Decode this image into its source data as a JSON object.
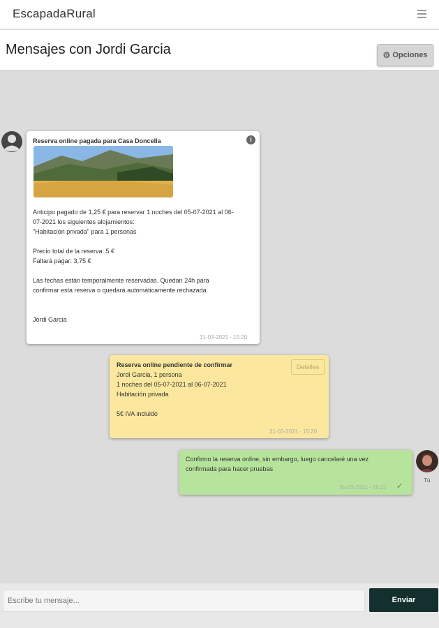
{
  "app": {
    "brand": "EscapadaRural",
    "menu_icon": "hamburger-icon"
  },
  "header": {
    "title": "Mensajes con Jordi Garcia",
    "options_label": "Opciones",
    "options_icon": "gear-icon"
  },
  "messages": [
    {
      "title": "Reserva online pagada para Casa Doncella",
      "lines_a": [
        "Anticipo pagado de 1,25 € para reservar 1 noches del 05-07-2021 al 06-",
        "07-2021 los siguientes alojamientos:",
        "\"Habitación privada\" para 1 personas"
      ],
      "lines_b": [
        "Precio total de la reserva: 5 €",
        "Faltará pagar: 3,75 €"
      ],
      "lines_c": [
        "Las fechas están temporalmente reservadas. Quedan 24h para",
        "confirmar esta reserva o quedará automáticamente rechazada."
      ],
      "signature": "Jordi Garcia",
      "timestamp": "31-03-2021 - 15:20",
      "icon": "info-icon",
      "background": "#ffffff"
    },
    {
      "title": "Reserva online pendiente de confirmar",
      "lines": [
        "Jordi Garcia, 1 persona",
        "1 noches del 05-07-2021 al 06-07-2021",
        "Habitación privada"
      ],
      "price": "5€ IVA incluido",
      "details_label": "Detalles",
      "timestamp": "31-03-2021 - 15:20",
      "background": "#fbe89e"
    },
    {
      "lines": [
        "Confirmo la reserva online, sin embargo, luego cancelaré una vez",
        "confirmada para hacer pruebas"
      ],
      "timestamp": "31-03-2021 - 15:21",
      "status_icon": "checkmark-icon",
      "sender_label": "Tú",
      "background": "#b7e49c"
    }
  ],
  "composer": {
    "placeholder": "Escribe tu mensaje...",
    "send_label": "Enviar",
    "send_color": "#13302f"
  }
}
